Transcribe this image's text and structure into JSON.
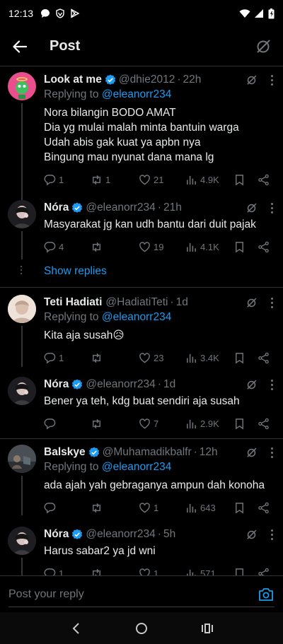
{
  "status": {
    "time": "12:13"
  },
  "header": {
    "title": "Post"
  },
  "tweets": [
    {
      "name": "Look at me",
      "handle": "@dhie2012",
      "time": "22h",
      "replying_prefix": "Replying to ",
      "replying_to": "@eleanorr234",
      "lines": [
        "Nora bilangin BODO AMAT",
        "Dia yg mulai malah minta bantuin warga",
        "Udah abis gak kuat ya apbn nya",
        "Bingung mau nyunat dana mana lg"
      ],
      "replies": "1",
      "retweets": "1",
      "likes": "21",
      "views": "4.9K",
      "avatar_color": "#e84f8c"
    },
    {
      "name": "Nóra",
      "handle": "@eleanorr234",
      "time": "21h",
      "lines": [
        "Masyarakat jg kan udh bantu dari duit pajak"
      ],
      "replies": "4",
      "retweets": "",
      "likes": "19",
      "views": "4.1K"
    },
    {
      "name": "Teti Hadiati",
      "handle": "@HadiatiTeti",
      "time": "1d",
      "replying_prefix": "Replying to ",
      "replying_to": "@eleanorr234",
      "lines": [
        "Kita aja susah😥"
      ],
      "replies": "1",
      "retweets": "",
      "likes": "23",
      "views": "3.4K"
    },
    {
      "name": "Nóra",
      "handle": "@eleanorr234",
      "time": "1d",
      "lines": [
        "Bener ya teh, kdg buat sendiri aja susah"
      ],
      "replies": "",
      "retweets": "",
      "likes": "7",
      "views": "2.9K"
    },
    {
      "name": "Balskye",
      "handle": "@Muhamadikbalfr",
      "time": "12h",
      "replying_prefix": "Replying to ",
      "replying_to": "@eleanorr234",
      "lines": [
        "ada ajah yah gebraganya ampun dah konoha"
      ],
      "replies": "",
      "retweets": "",
      "likes": "1",
      "views": "643"
    },
    {
      "name": "Nóra",
      "handle": "@eleanorr234",
      "time": "5h",
      "lines": [
        "Harus sabar2 ya jd wni"
      ],
      "replies": "1",
      "retweets": "",
      "likes": "1",
      "views": "571"
    }
  ],
  "show_replies": "Show replies",
  "reply_bar": {
    "placeholder": "Post your reply"
  },
  "colors": {
    "accent": "#1d9bf0",
    "muted": "#71767b",
    "background": "#000000"
  }
}
